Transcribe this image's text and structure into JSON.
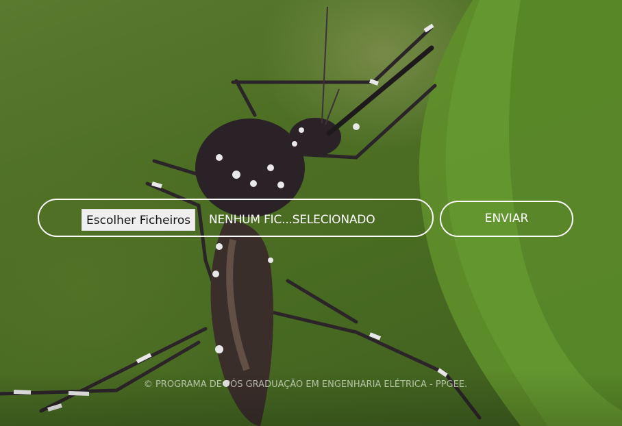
{
  "upload": {
    "choose_button_label": "Escolher Ficheiros",
    "file_status": "NENHUM FIC...SELECIONADO",
    "submit_label": "ENVIAR"
  },
  "footer": {
    "copyright": "© PROGRAMA DE PÓS GRADUAÇÃO EM ENGENHARIA ELÉTRICA - PPGEE."
  },
  "background": {
    "subject": "mosquito-photo",
    "colors": {
      "green_dark": "#3f5f1f",
      "green_mid": "#4d6f24",
      "leaf": "#5f8f2a",
      "mosquito_body": "#2a2226",
      "mosquito_stripe": "#e8e8e8"
    }
  }
}
